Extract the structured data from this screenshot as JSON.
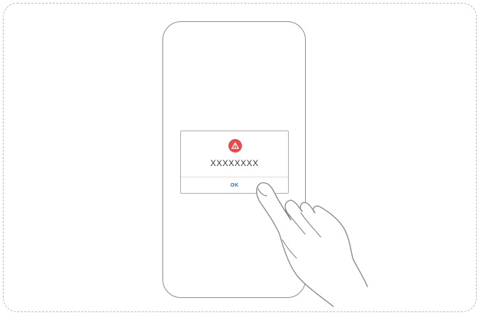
{
  "dialog": {
    "icon": "warning-icon",
    "message": "XXXXXXXX",
    "ok_label": "OK"
  },
  "colors": {
    "warning": "#e8494b",
    "ok_button": "#2a6fd6",
    "outline": "#8a8a8a"
  }
}
